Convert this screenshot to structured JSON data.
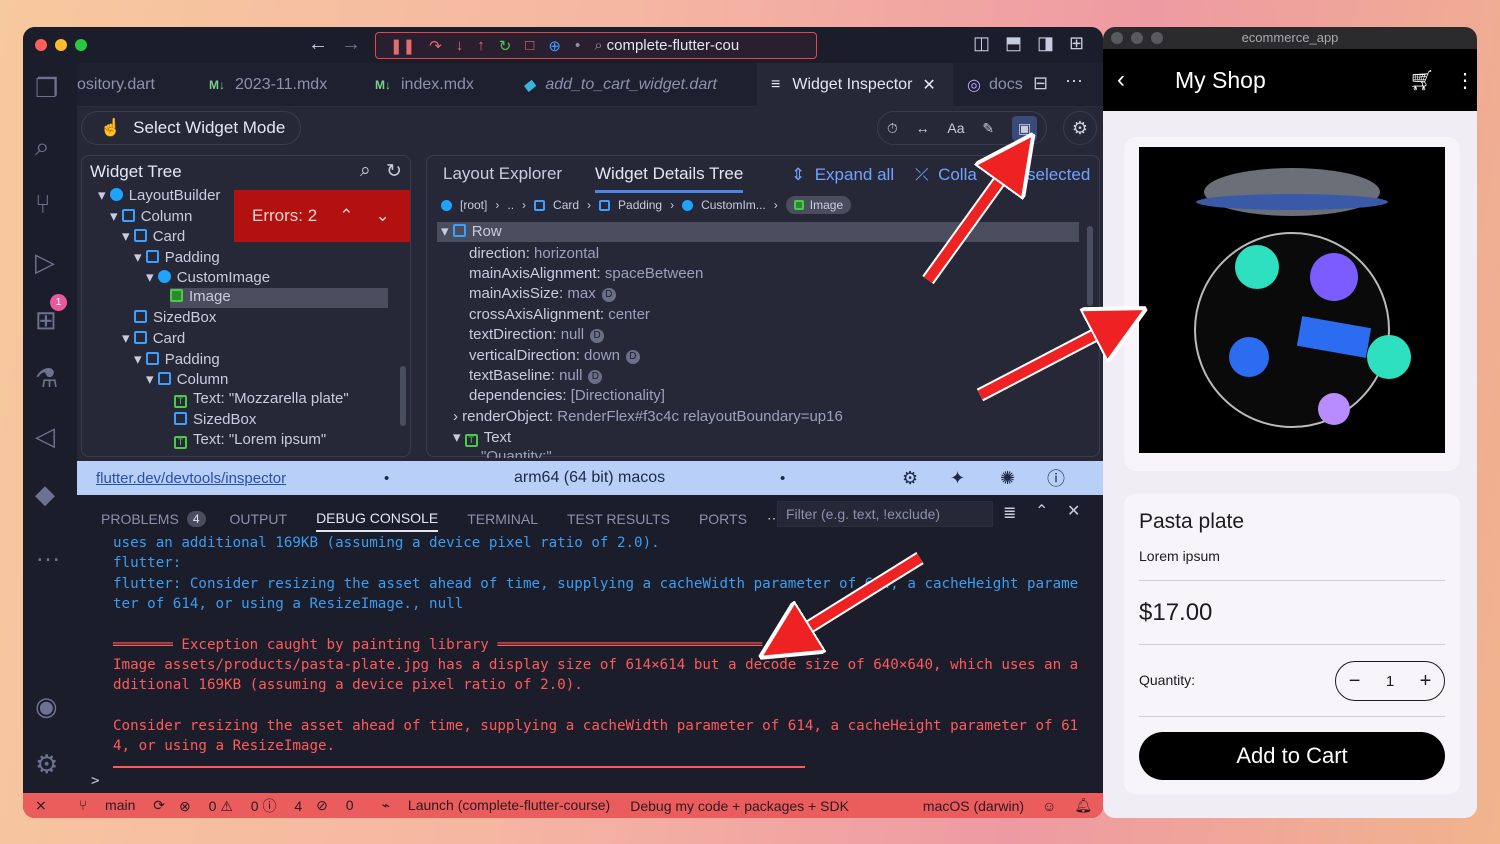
{
  "titlebar": {
    "search": "complete-flutter-cou"
  },
  "tabs": [
    {
      "label": "ository.dart"
    },
    {
      "label": "2023-11.mdx"
    },
    {
      "label": "index.mdx"
    },
    {
      "label": "add_to_cart_widget.dart"
    },
    {
      "label": "Widget Inspector"
    },
    {
      "label": "docs"
    }
  ],
  "inspector": {
    "select_mode": "Select Widget Mode",
    "tree_title": "Widget Tree",
    "errors": "Errors: 2",
    "tree": [
      "LayoutBuilder",
      "Column",
      "Card",
      "Padding",
      "CustomImage",
      "Image",
      "SizedBox",
      "Card",
      "Padding",
      "Column",
      "Text: \"Mozzarella plate\"",
      "SizedBox",
      "Text: \"Lorem ipsum\""
    ],
    "tab_layout": "Layout Explorer",
    "tab_details": "Widget Details Tree",
    "expand_all": "Expand all",
    "collapse": "Colla",
    "selected": "selected",
    "crumbs": [
      "[root]",
      "..",
      "Card",
      "Padding",
      "CustomIm...",
      "Image"
    ],
    "details_root": "Row",
    "props": [
      {
        "k": "direction:",
        "v": "horizontal"
      },
      {
        "k": "mainAxisAlignment:",
        "v": "spaceBetween"
      },
      {
        "k": "mainAxisSize:",
        "v": "max"
      },
      {
        "k": "crossAxisAlignment:",
        "v": "center"
      },
      {
        "k": "textDirection:",
        "v": "null"
      },
      {
        "k": "verticalDirection:",
        "v": "down"
      },
      {
        "k": "textBaseline:",
        "v": "null"
      },
      {
        "k": "dependencies:",
        "v": "[Directionality]"
      }
    ],
    "render_object": "renderObject:",
    "render_value": "RenderFlex#f3c4c relayoutBoundary=up16",
    "text_node": "Text",
    "quantity_partial": "\"Quantity:\"",
    "url": "flutter.dev/devtools/inspector",
    "device": "arm64 (64 bit) macos"
  },
  "panel": {
    "tabs": [
      "PROBLEMS",
      "OUTPUT",
      "DEBUG CONSOLE",
      "TERMINAL",
      "TEST RESULTS",
      "PORTS"
    ],
    "problems_count": "4",
    "filter": "Filter (e.g. text, !exclude)"
  },
  "console": {
    "l1": "uses an additional 169KB (assuming a device pixel ratio of 2.0).",
    "l2": "flutter:",
    "l3": "flutter: Consider resizing the asset ahead of time, supplying a cacheWidth parameter of 614, a cacheHeight parame",
    "l4": "ter of 614, or using a ResizeImage., null",
    "l5": "═══════ Exception caught by painting library ═══════════════════════════════",
    "l6": "Image assets/products/pasta-plate.jpg has a display size of 614×614 but a decode size of 640×640, which uses an a",
    "l7": "dditional 169KB (assuming a device pixel ratio of 2.0).",
    "l8": "Consider resizing the asset ahead of time, supplying a cacheWidth parameter of 614, a cacheHeight parameter of 61",
    "l9": "4, or using a ResizeImage.",
    "prompt": ">"
  },
  "status": {
    "branch": "main",
    "errors": "0",
    "warnings": "0",
    "info": "4",
    "ports": "0",
    "launch": "Launch (complete-flutter-course)",
    "debug": "Debug my code + packages + SDK",
    "platform": "macOS (darwin)"
  },
  "activity": {
    "debug_badge": "1"
  },
  "sim": {
    "window_title": "ecommerce_app",
    "appbar_title": "My Shop",
    "product": "Pasta plate",
    "desc": "Lorem ipsum",
    "price": "$17.00",
    "qty_label": "Quantity:",
    "qty": "1",
    "add": "Add to Cart"
  },
  "colors": {
    "accent_red": "#eb5c5c",
    "inspector_blue": "#3ca0ff",
    "error_bg": "#b31010"
  }
}
